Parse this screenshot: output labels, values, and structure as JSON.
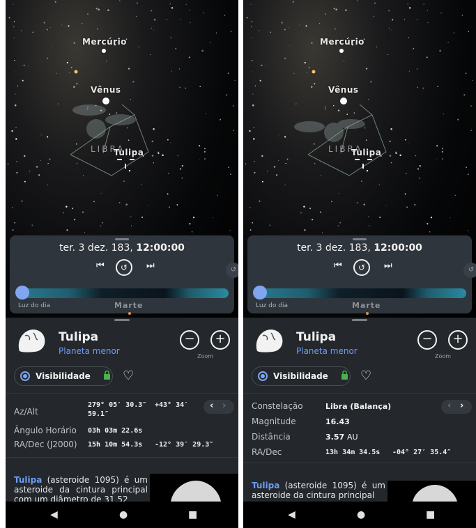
{
  "left": {
    "sky": {
      "planets": [
        {
          "name": "Mercúrio"
        },
        {
          "name": "Vênus"
        }
      ],
      "constellation": "LIBRA",
      "target": "Tulipa"
    },
    "time": {
      "date": "ter. 3 dez. 183,",
      "clock": "12:00:00",
      "daylight_label": "Luz do dia",
      "marker_label": "Marte"
    },
    "object": {
      "name": "Tulipa",
      "type": "Planeta menor",
      "zoom_label": "Zoom",
      "visibility_label": "Visibilidade"
    },
    "rows": [
      {
        "label": "Az/Alt",
        "v1": "279° 05′ 30.3″",
        "v1b": "59.1″",
        "v2": "+43° 34′"
      },
      {
        "label": "Ângulo Horário",
        "v1": "03h 03m 22.6s",
        "v2": ""
      },
      {
        "label": "RA/Dec (J2000)",
        "v1": "15h 10m 54.3s",
        "v2": "-12° 39′ 29.3″"
      }
    ],
    "description": {
      "name": "Tulipa",
      "text": " (asteroide 1095) é um asteroide da cintura principal com um diâmetro de 31,52"
    }
  },
  "right": {
    "sky": {
      "planets": [
        {
          "name": "Mercúrio"
        },
        {
          "name": "Vênus"
        }
      ],
      "constellation": "LIBRA",
      "target": "Tulipa"
    },
    "time": {
      "date": "ter. 3 dez. 183,",
      "clock": "12:00:00",
      "daylight_label": "Luz do dia",
      "marker_label": "Marte"
    },
    "object": {
      "name": "Tulipa",
      "type": "Planeta menor",
      "zoom_label": "Zoom",
      "visibility_label": "Visibilidade"
    },
    "rows": [
      {
        "label": "Constelação",
        "value": "Libra (Balança)"
      },
      {
        "label": "Magnitude",
        "value": "16.43"
      },
      {
        "label": "Distância",
        "value": "3.57",
        "unit": "AU"
      },
      {
        "label": "RA/Dec",
        "v1": "13h 34m 34.5s",
        "v2": "-04° 27′ 35.4″"
      }
    ],
    "description": {
      "name": "Tulipa",
      "text": " (asteroide 1095) é um asteroide da cintura principal"
    }
  },
  "icons": {
    "prev": "skip-previous-icon",
    "reset": "history-icon",
    "next": "skip-next-icon",
    "zoom_out": "minus-circle-icon",
    "zoom_in": "plus-circle-icon",
    "favorite": "heart-icon",
    "lock": "lock-icon",
    "back": "back-triangle-icon",
    "home": "home-circle-icon",
    "recents": "recents-square-icon"
  },
  "colors": {
    "accent_blue": "#7fa6ef",
    "link_blue": "#6d9cf0",
    "lock_green": "#4caf50",
    "sheet_bg": "#24282d",
    "card_bg": "#2f353c"
  }
}
